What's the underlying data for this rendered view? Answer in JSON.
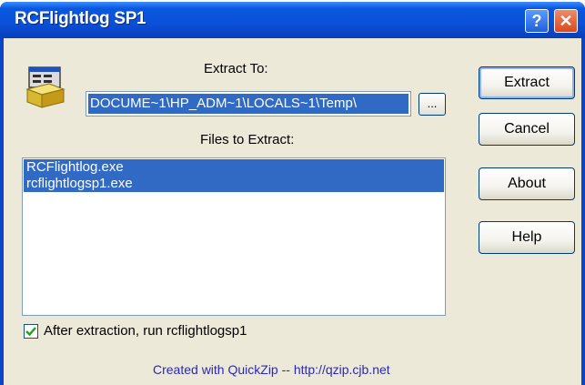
{
  "window": {
    "title": "RCFlightlog SP1"
  },
  "titlebar": {
    "help_glyph": "?",
    "close_glyph": "✕"
  },
  "extract_to": {
    "label": "Extract To:",
    "path_value": "DOCUME~1\\HP_ADM~1\\LOCALS~1\\Temp\\",
    "browse_label": "..."
  },
  "files": {
    "label": "Files to Extract:",
    "items": [
      "RCFlightlog.exe",
      "rcflightlogsp1.exe"
    ]
  },
  "run_after": {
    "checked": true,
    "label": "After extraction,  run  rcflightlogsp1"
  },
  "footer": {
    "text": "Created with QuickZip --  http://qzip.cjb.net"
  },
  "buttons": {
    "extract": "Extract",
    "cancel": "Cancel",
    "about": "About",
    "help": "Help"
  },
  "icons": {
    "package": "installer-package-icon",
    "checkbox": "checkmark-icon"
  },
  "colors": {
    "titlebar": "#0a50d8",
    "selection": "#316ac5",
    "dialog_bg": "#ece9d8",
    "footer_text": "#2a2ab0"
  }
}
